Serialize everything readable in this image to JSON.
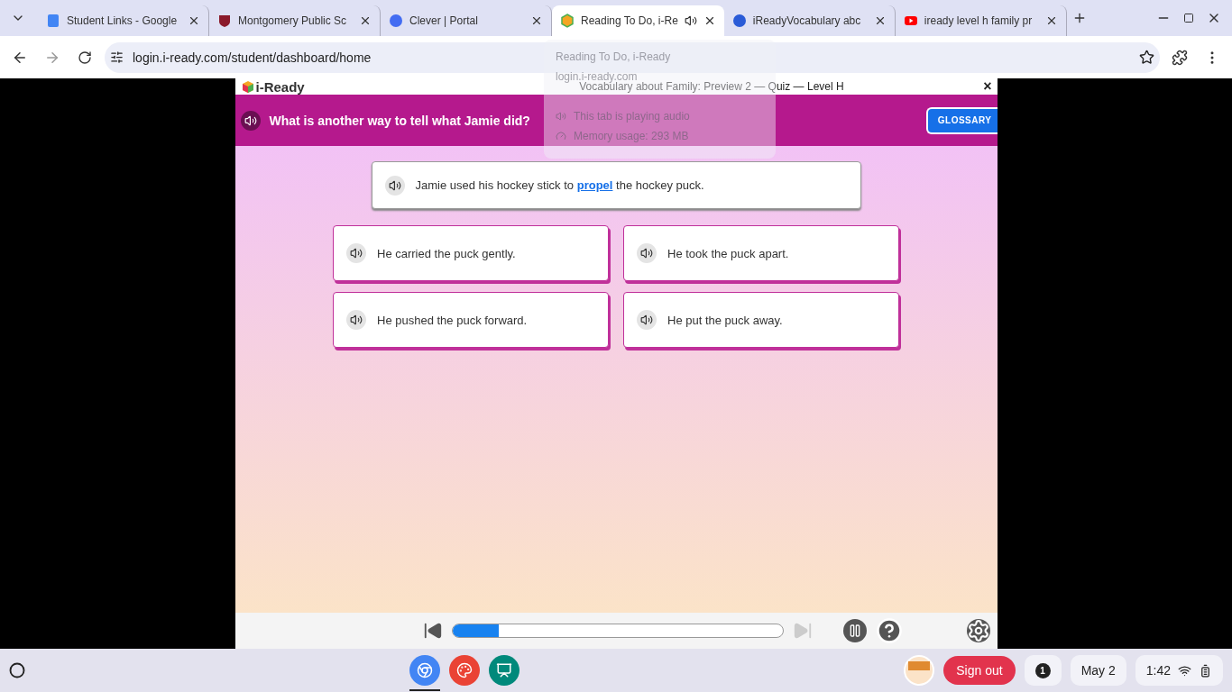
{
  "tabs": [
    {
      "title": "Student Links - Google",
      "kind": "docs",
      "selected": false,
      "audio": false
    },
    {
      "title": "Montgomery Public Sc",
      "kind": "crest",
      "selected": false,
      "audio": false
    },
    {
      "title": "Clever | Portal",
      "kind": "clever",
      "selected": false,
      "audio": false
    },
    {
      "title": "Reading To Do, i-Re",
      "kind": "cube",
      "selected": true,
      "audio": true
    },
    {
      "title": "iReadyVocabulary abc",
      "kind": "filo",
      "selected": false,
      "audio": false
    },
    {
      "title": "iready level h family pr",
      "kind": "youtube",
      "selected": false,
      "audio": false
    }
  ],
  "address": "login.i-ready.com/student/dashboard/home",
  "hover_card": {
    "title": "Reading To Do, i-Ready",
    "url": "login.i-ready.com",
    "audio": "This tab is playing audio",
    "memory": "Memory usage: 293 MB"
  },
  "app": {
    "logo": "i-Ready",
    "title": "Vocabulary about Family: Preview 2 — Quiz — Level H",
    "close": "×",
    "question": "What is another way to tell what Jamie did?",
    "glossary": "GLOSSARY",
    "sentence_parts": [
      "Jamie used his hockey stick to ",
      "propel",
      " the hockey puck."
    ],
    "choices": [
      {
        "text": "He carried the puck gently.",
        "selected": false
      },
      {
        "text": "He took the puck apart.",
        "selected": false
      },
      {
        "text": "He pushed the puck forward.",
        "selected": false
      },
      {
        "text": "He put the puck away.",
        "selected": false
      }
    ],
    "progress": {
      "level": 0.14
    }
  },
  "shelf": {
    "apps": [
      {
        "kind": "chrome",
        "active": true
      },
      {
        "kind": "palette",
        "active": false
      },
      {
        "kind": "slides",
        "active": false
      }
    ],
    "sign_out": "Sign out",
    "notifications": "1",
    "date": "May 2",
    "time": "1:42"
  }
}
